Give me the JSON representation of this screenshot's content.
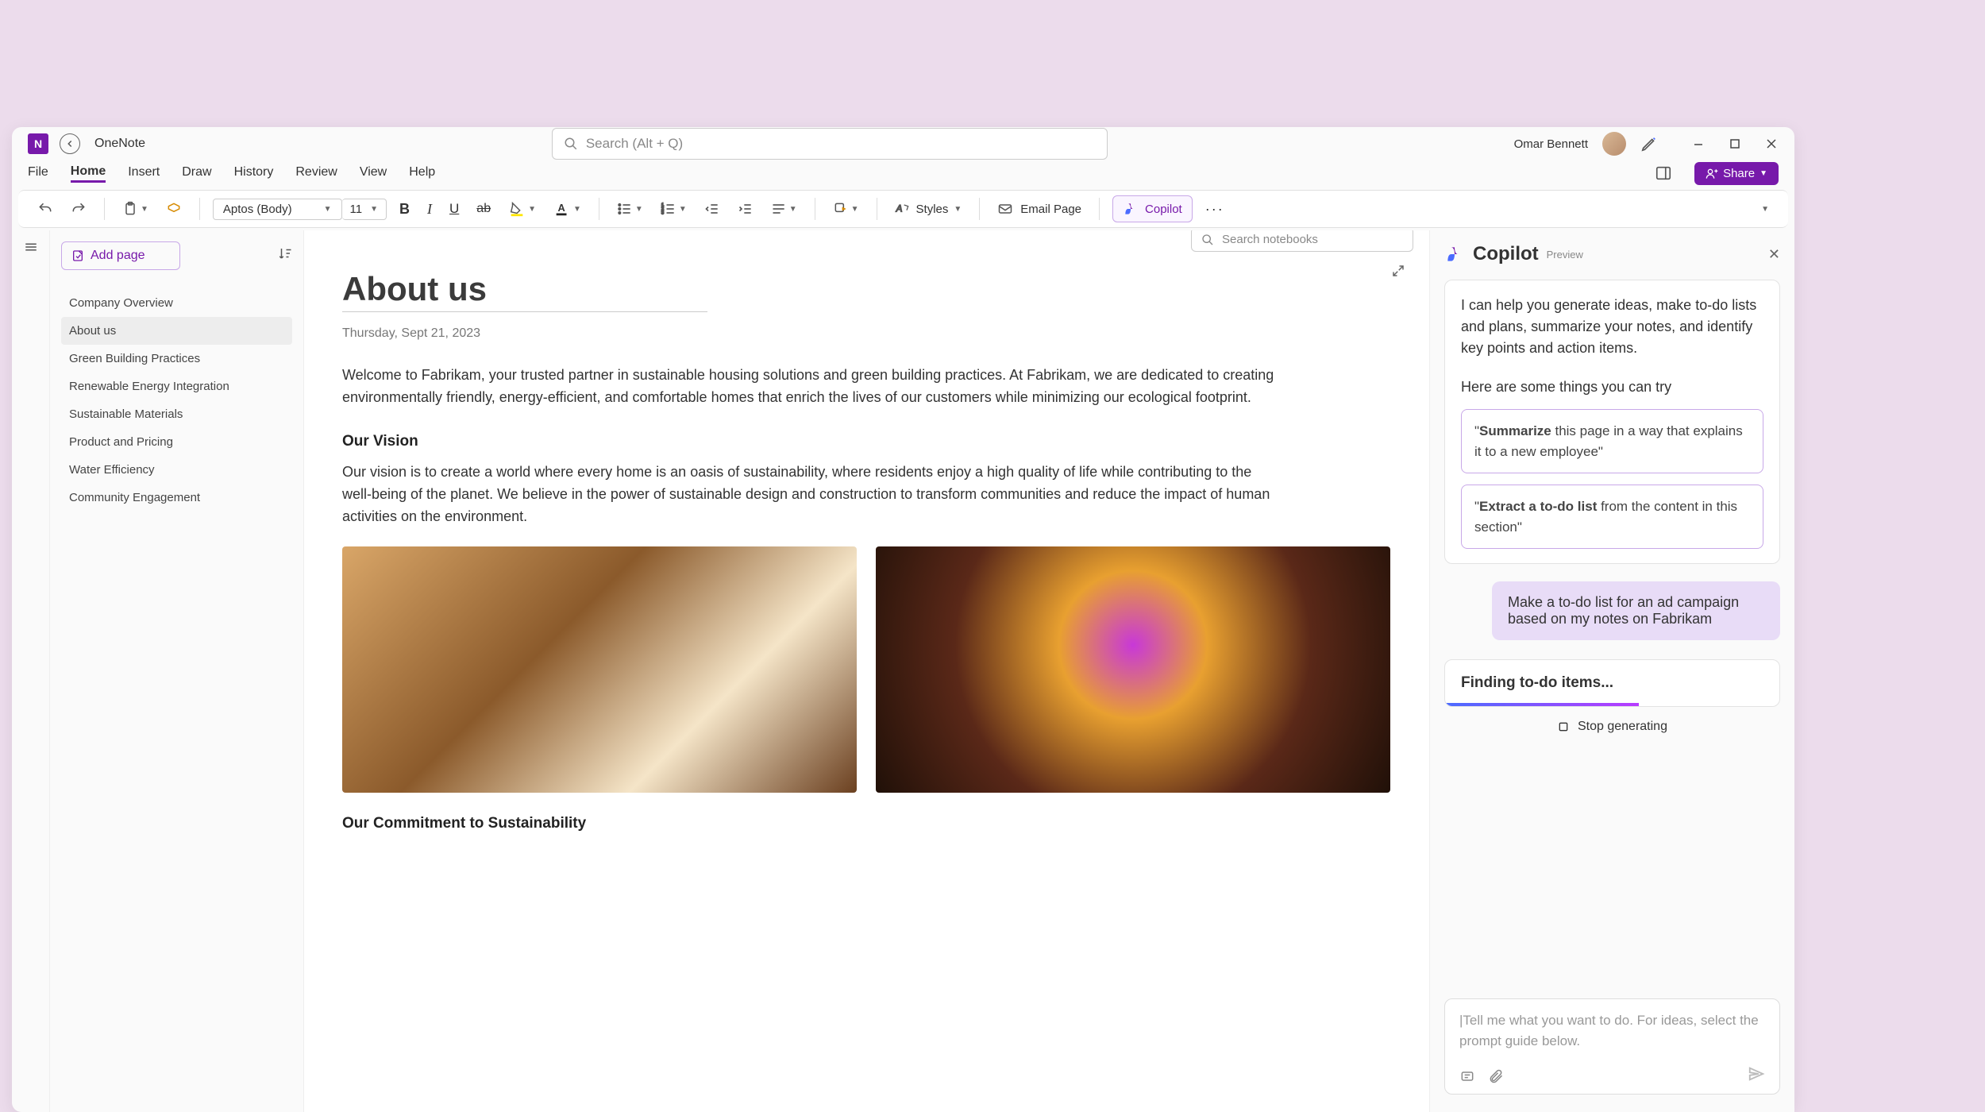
{
  "app": {
    "name": "OneNote"
  },
  "search": {
    "placeholder": "Search (Alt + Q)"
  },
  "user": {
    "name": "Omar Bennett"
  },
  "menu": {
    "items": [
      "File",
      "Home",
      "Insert",
      "Draw",
      "History",
      "Review",
      "View",
      "Help"
    ],
    "active": 1,
    "share": "Share"
  },
  "ribbon": {
    "font": "Aptos (Body)",
    "size": "11",
    "styles": "Styles",
    "email": "Email Page",
    "copilot": "Copilot"
  },
  "notebook_search": "Search notebooks",
  "pagelist": {
    "add": "Add page",
    "items": [
      "Company Overview",
      "About us",
      "Green Building Practices",
      "Renewable Energy Integration",
      "Sustainable Materials",
      "Product and Pricing",
      "Water Efficiency",
      "Community Engagement"
    ],
    "selected": 1
  },
  "page": {
    "title": "About us",
    "date": "Thursday, Sept 21, 2023",
    "intro": "Welcome to Fabrikam, your trusted partner in sustainable housing solutions and green building practices. At Fabrikam, we are dedicated to creating environmentally friendly, energy-efficient, and comfortable homes that enrich the lives of our customers while minimizing our ecological footprint.",
    "vision_h": "Our Vision",
    "vision": "Our vision is to create a world where every home is an oasis of sustainability, where residents enjoy a high quality of life while contributing to the well-being of the planet. We believe in the power of sustainable design and construction to transform communities and reduce the impact of human activities on the environment.",
    "commit_h": "Our Commitment to Sustainability"
  },
  "copilot": {
    "title": "Copilot",
    "preview": "Preview",
    "intro": "I can help you generate ideas, make to-do lists and plans, summarize your notes, and identify key points and action items.",
    "try": "Here are some things you can try",
    "sugg1_b": "Summarize",
    "sugg1_r": " this page in a way that explains it to a new employee\"",
    "sugg2_b": "Extract a to-do list",
    "sugg2_r": " from the content in this section\"",
    "usermsg": "Make a to-do list for an ad campaign based on my notes on Fabrikam",
    "status": "Finding to-do items...",
    "stop": "Stop generating",
    "input_ph": "|Tell me what you want to do. For ideas, select the prompt guide below."
  }
}
